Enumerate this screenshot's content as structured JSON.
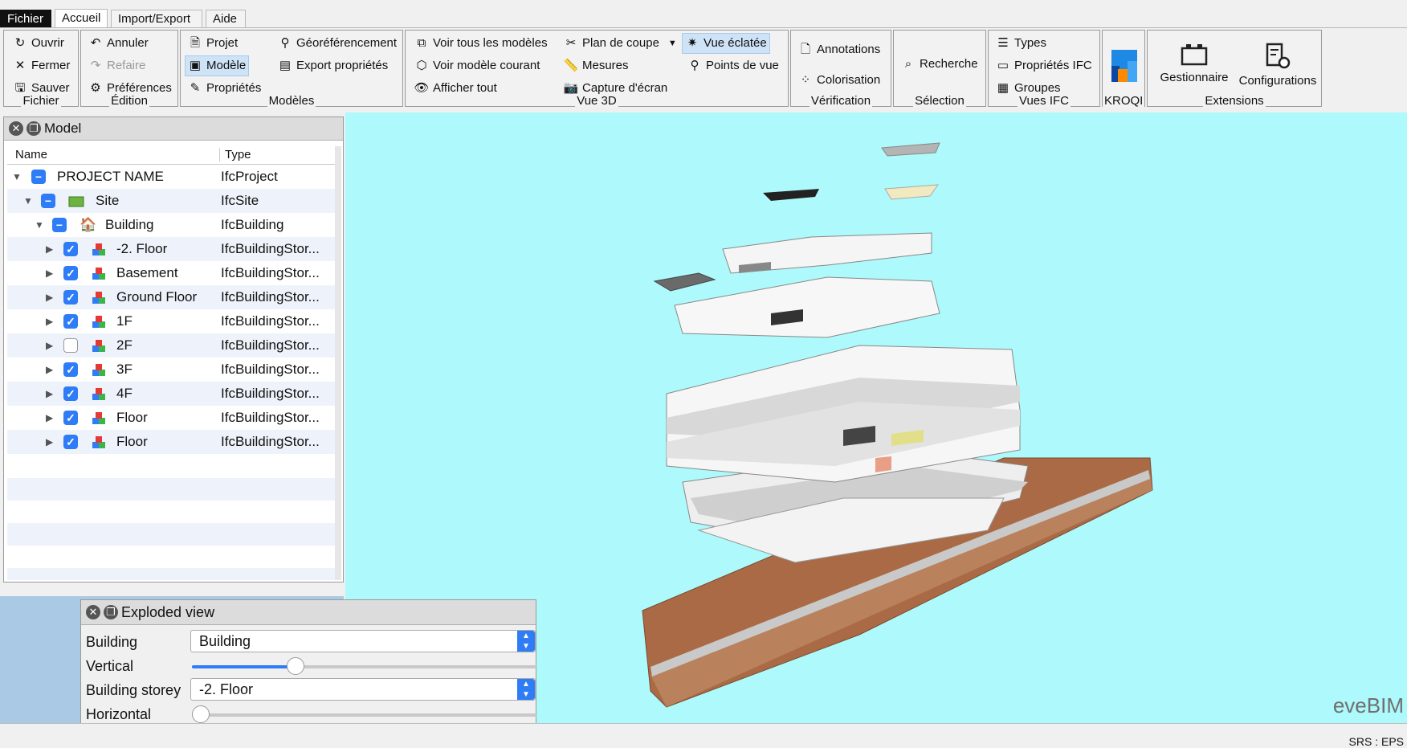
{
  "menubar": {
    "tabs": [
      "Fichier",
      "Accueil",
      "Import/Export",
      "Aide"
    ]
  },
  "ribbon": {
    "fichier": {
      "title": "Fichier",
      "ouvrir": "Ouvrir",
      "fermer": "Fermer",
      "sauver": "Sauver"
    },
    "edition": {
      "title": "Édition",
      "annuler": "Annuler",
      "refaire": "Refaire",
      "preferences": "Préférences"
    },
    "modeles": {
      "title": "Modèles",
      "projet": "Projet",
      "modele": "Modèle",
      "proprietes": "Propriétés",
      "georef": "Géoréférencement",
      "export": "Export propriétés"
    },
    "vue3d": {
      "title": "Vue 3D",
      "voir_tous": "Voir tous les modèles",
      "voir_courant": "Voir modèle courant",
      "afficher_tout": "Afficher tout",
      "plan_coupe": "Plan de coupe",
      "mesures": "Mesures",
      "capture": "Capture d'écran",
      "vue_eclatee": "Vue éclatée",
      "points_vue": "Points de vue"
    },
    "verification": {
      "title": "Vérification",
      "annotations": "Annotations",
      "colorisation": "Colorisation"
    },
    "selection": {
      "title": "Sélection",
      "recherche": "Recherche"
    },
    "vues_ifc": {
      "title": "Vues IFC",
      "types": "Types",
      "proprietes_ifc": "Propriétés IFC",
      "groupes": "Groupes"
    },
    "kroqi": {
      "title": "KROQI"
    },
    "extensions": {
      "title": "Extensions",
      "gestionnaire": "Gestionnaire",
      "configurations": "Configurations"
    }
  },
  "model_panel": {
    "title": "Model",
    "col_name": "Name",
    "col_type": "Type",
    "rows": [
      {
        "name": "PROJECT NAME",
        "type": "IfcProject"
      },
      {
        "name": "Site",
        "type": "IfcSite"
      },
      {
        "name": "Building",
        "type": "IfcBuilding"
      },
      {
        "name": "-2. Floor",
        "type": "IfcBuildingStor...",
        "checked": true
      },
      {
        "name": "Basement",
        "type": "IfcBuildingStor...",
        "checked": true
      },
      {
        "name": "Ground Floor",
        "type": "IfcBuildingStor...",
        "checked": true
      },
      {
        "name": "1F",
        "type": "IfcBuildingStor...",
        "checked": true
      },
      {
        "name": "2F",
        "type": "IfcBuildingStor...",
        "checked": false
      },
      {
        "name": "3F",
        "type": "IfcBuildingStor...",
        "checked": true
      },
      {
        "name": "4F",
        "type": "IfcBuildingStor...",
        "checked": true
      },
      {
        "name": "Floor",
        "type": "IfcBuildingStor...",
        "checked": true
      },
      {
        "name": "Floor",
        "type": "IfcBuildingStor...",
        "checked": true
      }
    ]
  },
  "exploded_view": {
    "title": "Exploded view",
    "building_label": "Building",
    "building_value": "Building",
    "vertical_label": "Vertical",
    "vertical_value": 0.3,
    "storey_label": "Building storey",
    "storey_value": "-2. Floor",
    "horizontal_label": "Horizontal",
    "horizontal_value": 0.0
  },
  "viewport": {
    "watermark": "eveBIM",
    "background": "#aef9fb"
  },
  "status": {
    "text": "SRS : EPS"
  }
}
